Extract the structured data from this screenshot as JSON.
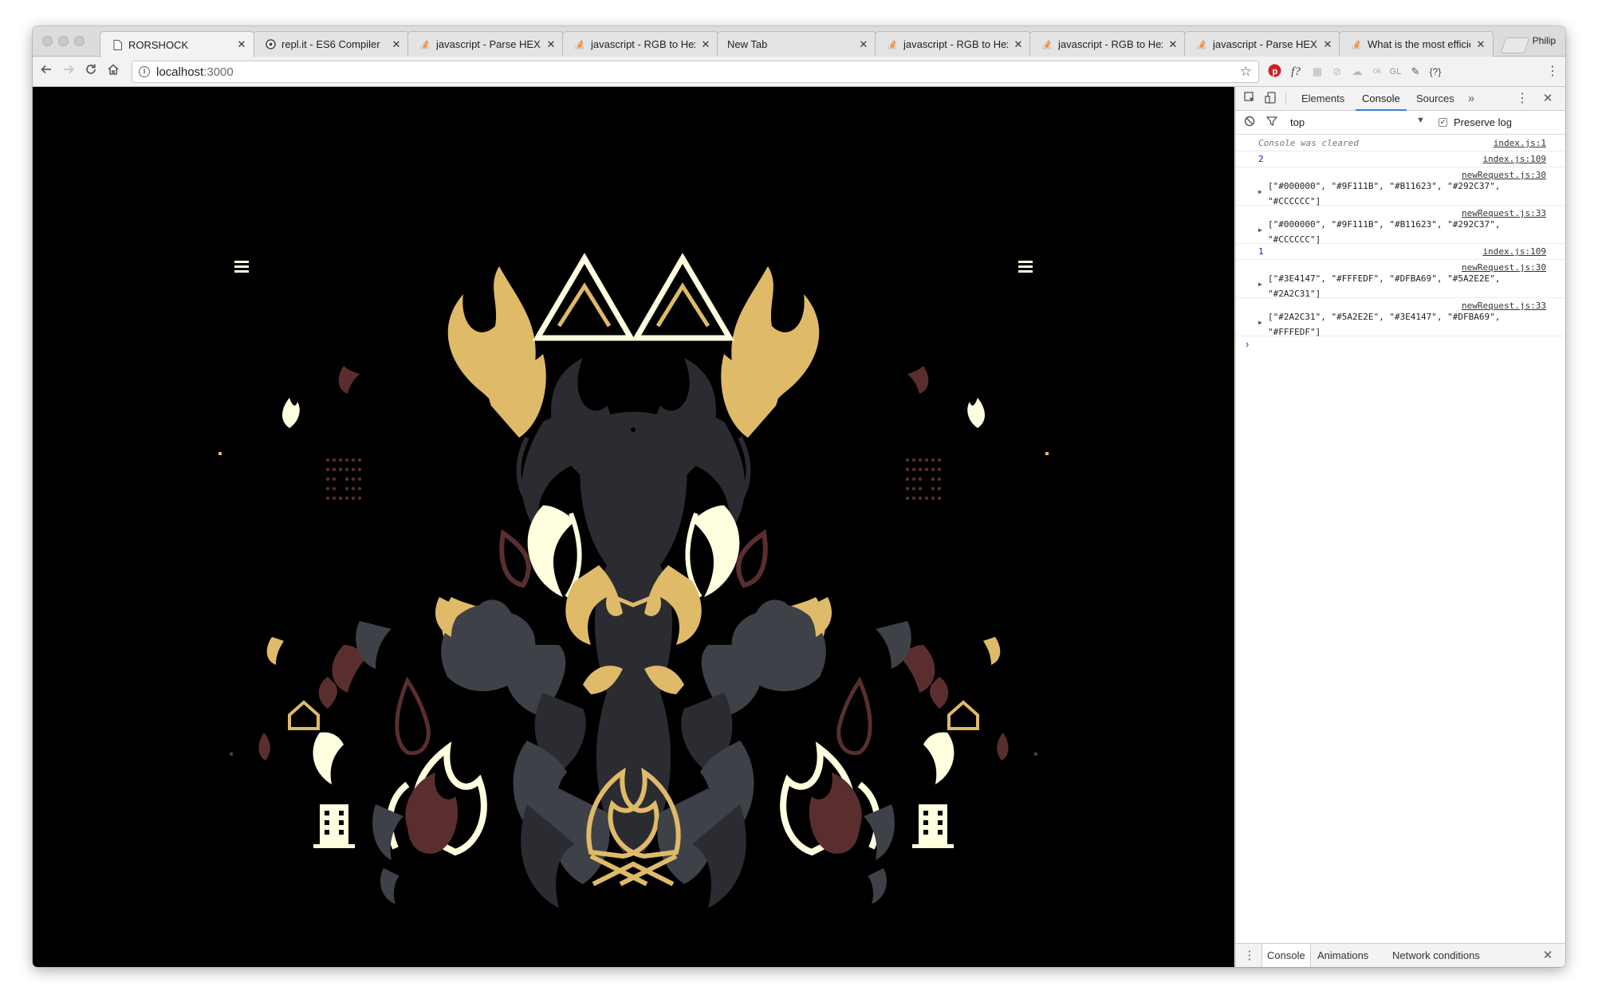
{
  "browser": {
    "tabs": [
      {
        "title": "RORSHOCK",
        "icon": "document-icon",
        "active": true
      },
      {
        "title": "repl.it - ES6 Compiler",
        "icon": "replit-icon"
      },
      {
        "title": "javascript - Parse HEX AS",
        "icon": "stackoverflow-icon"
      },
      {
        "title": "javascript - RGB to Hex a",
        "icon": "stackoverflow-icon"
      },
      {
        "title": "New Tab",
        "icon": ""
      },
      {
        "title": "javascript - RGB to Hex a",
        "icon": "stackoverflow-icon"
      },
      {
        "title": "javascript - RGB to Hex a",
        "icon": "stackoverflow-icon"
      },
      {
        "title": "javascript - Parse HEX As",
        "icon": "stackoverflow-icon"
      },
      {
        "title": "What is the most efficient",
        "icon": "stackoverflow-icon"
      }
    ],
    "profile_name": "Philip",
    "url_host": "localhost",
    "url_port": ":3000",
    "extensions": [
      "pinterest-icon",
      "f?",
      "ext-icon",
      "ext-icon",
      "ext-icon",
      "ext-icon",
      "GL",
      "ext-icon",
      "{?}"
    ]
  },
  "devtools": {
    "tabs": [
      "Elements",
      "Console",
      "Sources"
    ],
    "active_tab": "Console",
    "context": "top",
    "preserve_log_label": "Preserve log",
    "preserve_log_checked": true,
    "messages": [
      {
        "kind": "cleared",
        "text": "Console was cleared",
        "source": "index.js:1"
      },
      {
        "kind": "num",
        "text": "2",
        "source": "index.js:109"
      },
      {
        "kind": "arr",
        "source": "newRequest.js:30",
        "line1": "[\"#000000\", \"#9F111B\", \"#B11623\", \"#292C37\",",
        "line2": "\"#CCCCCC\"]"
      },
      {
        "kind": "arr",
        "source": "newRequest.js:33",
        "line1": "[\"#000000\", \"#9F111B\", \"#B11623\", \"#292C37\",",
        "line2": "\"#CCCCCC\"]"
      },
      {
        "kind": "num",
        "text": "1",
        "source": "index.js:109"
      },
      {
        "kind": "arr",
        "source": "newRequest.js:30",
        "line1": "[\"#3E4147\", \"#FFFEDF\", \"#DFBA69\", \"#5A2E2E\",",
        "line2": "\"#2A2C31\"]"
      },
      {
        "kind": "arr",
        "source": "newRequest.js:33",
        "line1": "[\"#2A2C31\", \"#5A2E2E\", \"#3E4147\", \"#DFBA69\",",
        "line2": "\"#FFFEDF\"]"
      }
    ],
    "drawer_tabs": [
      "Console",
      "Animations",
      "Network conditions"
    ]
  },
  "artwork": {
    "palette": {
      "gold": "#DFBA69",
      "cream": "#FFFEDF",
      "maroon": "#5A2E2E",
      "grey": "#3E4147",
      "dark": "#2A2C31"
    }
  }
}
